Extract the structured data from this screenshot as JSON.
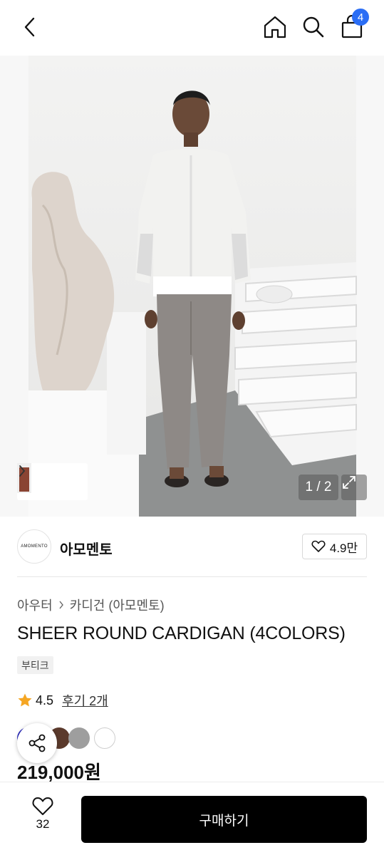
{
  "header": {
    "back_icon": "chevron-left-icon",
    "home_icon": "home-icon",
    "search_icon": "search-icon",
    "cart_icon": "shopping-bag-icon",
    "cart_count": "4",
    "badge_color": "#2b6ef5"
  },
  "gallery": {
    "page_indicator": "1 / 2",
    "expand_icon": "expand-icon",
    "thumbnail_chevron": "chevron-right-icon"
  },
  "brand": {
    "logo_text": "AMOMENTO",
    "name": "아모멘토",
    "like_count": "4.9만",
    "like_icon": "heart-outline-icon"
  },
  "product": {
    "breadcrumb": [
      "아우터",
      "카디건 (아모멘토)"
    ],
    "title": "SHEER ROUND CARDIGAN (4COLORS)",
    "tag": "부티크",
    "rating": "4.5",
    "review_link": "후기 2개",
    "rating_star_color": "#f5a623",
    "swatch_colors": [
      "#2c2cc0",
      "#5b3a2c",
      "#9e9e9e",
      "#ffffff"
    ],
    "price": "219,000원"
  },
  "share": {
    "icon": "share-icon"
  },
  "bottom_bar": {
    "wish_count": "32",
    "buy_label": "구매하기"
  }
}
